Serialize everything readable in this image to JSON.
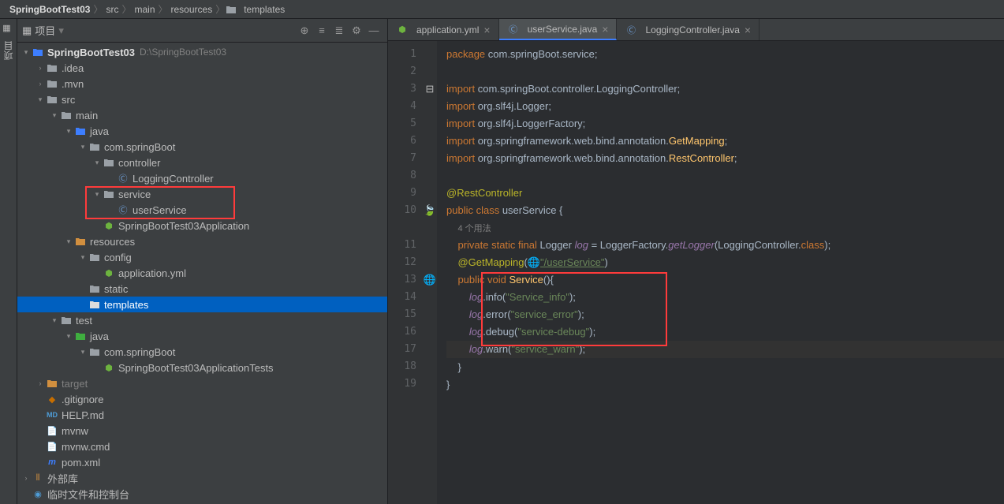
{
  "breadcrumbs": [
    "SpringBootTest03",
    "src",
    "main",
    "resources",
    "templates"
  ],
  "sidebar": {
    "title": "项目",
    "gutterLabel": "项目"
  },
  "tree": {
    "root": "SpringBootTest03",
    "rootPath": "D:\\SpringBootTest03",
    "idea": ".idea",
    "mvn": ".mvn",
    "src": "src",
    "main": "main",
    "java": "java",
    "pkg": "com.springBoot",
    "controller": "controller",
    "loggingController": "LoggingController",
    "service": "service",
    "userService": "userService",
    "app": "SpringBootTest03Application",
    "resources": "resources",
    "config": "config",
    "appYml": "application.yml",
    "static": "static",
    "templates": "templates",
    "test": "test",
    "testJava": "java",
    "testPkg": "com.springBoot",
    "appTests": "SpringBootTest03ApplicationTests",
    "target": "target",
    "gitignore": ".gitignore",
    "help": "HELP.md",
    "mvnw": "mvnw",
    "mvnwCmd": "mvnw.cmd",
    "pom": "pom.xml",
    "extLib": "外部库",
    "scratch": "临时文件和控制台"
  },
  "tabs": [
    {
      "label": "application.yml",
      "active": false
    },
    {
      "label": "userService.java",
      "active": true
    },
    {
      "label": "LoggingController.java",
      "active": false
    }
  ],
  "code": {
    "l1": "package com.springBoot.service;",
    "l2": "",
    "l3": "import com.springBoot.controller.LoggingController;",
    "l4": "import org.slf4j.Logger;",
    "l5": "import org.slf4j.LoggerFactory;",
    "l6": "import org.springframework.web.bind.annotation.GetMapping;",
    "l7": "import org.springframework.web.bind.annotation.RestController;",
    "l8": "",
    "l9": "@RestController",
    "l10": "public class userService {",
    "usages": "4 个用法",
    "l11": "    private static final Logger log = LoggerFactory.getLogger(LoggingController.class);",
    "l12a": "    @GetMapping(",
    "l12b": "\"/userService\"",
    "l12c": ")",
    "l13": "    public void Service(){",
    "l14a": "        log",
    "l14b": ".info(",
    "l14c": "\"Service_info\"",
    "l14d": ");",
    "l15a": "        log",
    "l15b": ".error(",
    "l15c": "\"service_error\"",
    "l15d": ");",
    "l16a": "        log",
    "l16b": ".debug(",
    "l16c": "\"service-debug\"",
    "l16d": ");",
    "l17a": "        log",
    "l17b": ".warn(",
    "l17c": "\"service_warn\"",
    "l17d": ");",
    "l18": "    }",
    "l19": "}"
  }
}
